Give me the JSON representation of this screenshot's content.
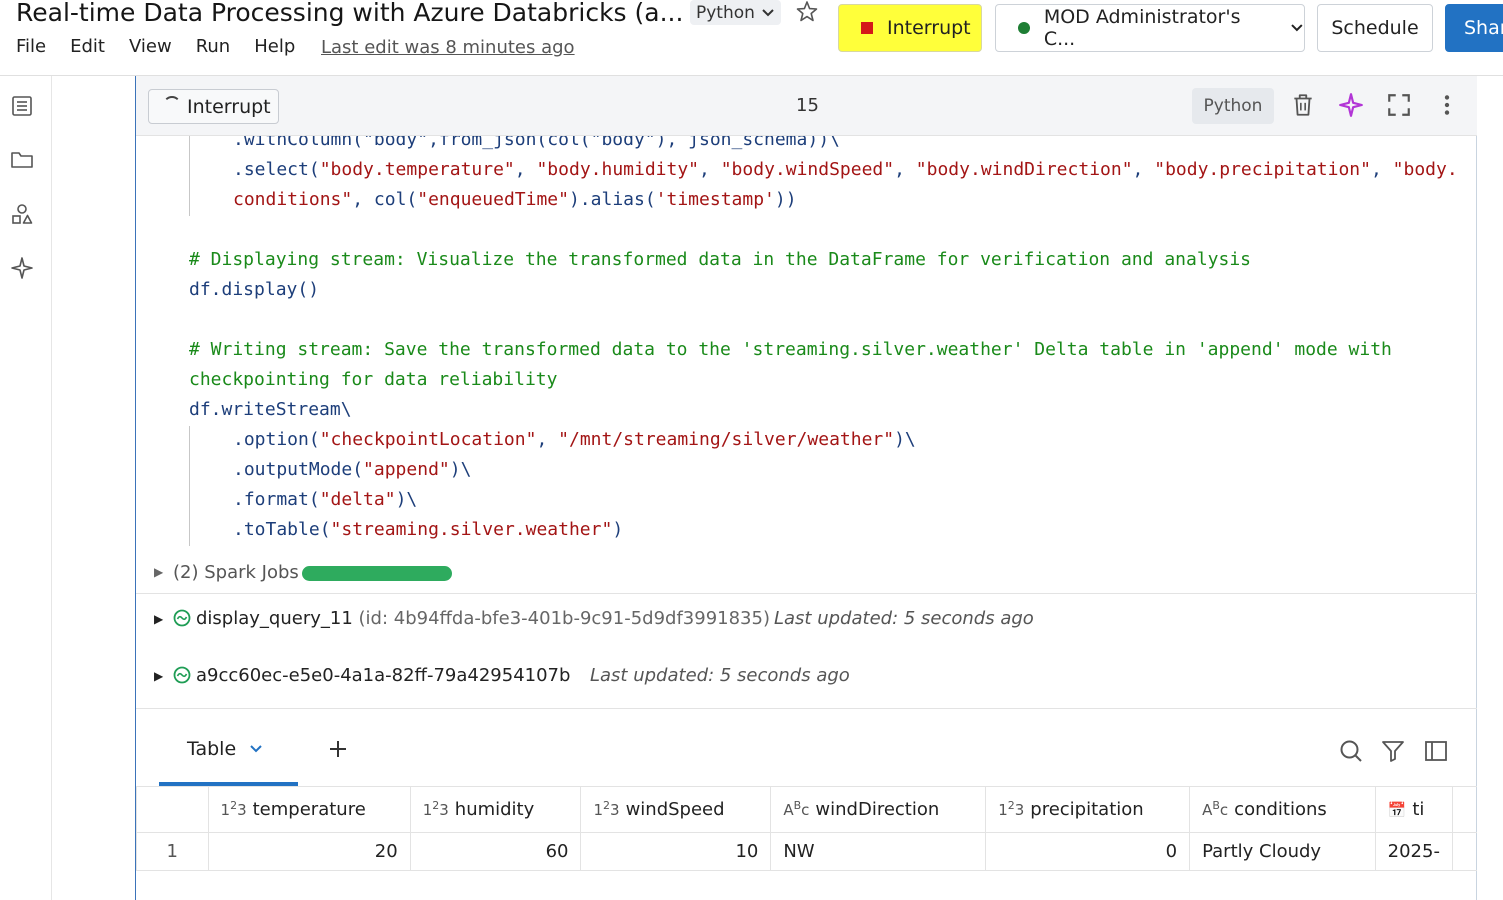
{
  "header": {
    "title": "Real-time Data Processing with Azure Databricks (a...",
    "language": "Python",
    "menu": [
      "File",
      "Edit",
      "View",
      "Run",
      "Help"
    ],
    "last_edit": "Last edit was 8 minutes ago",
    "interrupt_label": "Interrupt",
    "cluster_label": "MOD Administrator's C...",
    "schedule_label": "Schedule",
    "share_label": "Shar"
  },
  "cell": {
    "interrupt_label": "Interrupt",
    "number": "15",
    "language": "Python"
  },
  "code": {
    "line0": ".withColumn(\"body\",from_json(col(\"body\"), json_schema))\\",
    "line1a": ".select(",
    "line1b": "\"body.temperature\"",
    "line1c": ", ",
    "line1d": "\"body.humidity\"",
    "line1e": ", ",
    "line1f": "\"body.windSpeed\"",
    "line1g": ", ",
    "line1h": "\"body.windDirection\"",
    "line1i": ", ",
    "line1j": "\"body.precipitation\"",
    "line1k": ", ",
    "line1l": "\"body.",
    "line2a": "conditions\"",
    "line2b": ", col(",
    "line2c": "\"enqueuedTime\"",
    "line2d": ").alias(",
    "line2e": "'timestamp'",
    "line2f": "))",
    "comment1": "# Displaying stream: Visualize the transformed data in the DataFrame for verification and analysis",
    "display": "df.display()",
    "comment2a": "# Writing stream: Save the transformed data to the 'streaming.silver.weather' Delta table in 'append' mode with",
    "comment2b": "checkpointing for data reliability",
    "write": "df.writeStream\\",
    "opt_a": ".option(",
    "opt_b": "\"checkpointLocation\"",
    "opt_c": ", ",
    "opt_d": "\"/mnt/streaming/silver/weather\"",
    "opt_e": ")\\",
    "mode_a": ".outputMode(",
    "mode_b": "\"append\"",
    "mode_c": ")\\",
    "fmt_a": ".format(",
    "fmt_b": "\"delta\"",
    "fmt_c": ")\\",
    "tbl_a": ".toTable(",
    "tbl_b": "\"streaming.silver.weather\"",
    "tbl_c": ")"
  },
  "spark": {
    "label": "(2) Spark Jobs",
    "progress": 1.0,
    "color": "#2eab5e"
  },
  "queries": [
    {
      "name": "display_query_11",
      "id": "(id: 4b94ffda-bfe3-401b-9c91-5d9df3991835)",
      "updated": "Last updated: 5 seconds ago"
    },
    {
      "name": "a9cc60ec-e5e0-4a1a-82ff-79a42954107b",
      "id": "",
      "updated": "Last updated: 5 seconds ago"
    }
  ],
  "results": {
    "tab_label": "Table",
    "columns": [
      {
        "type": "123",
        "name": "temperature"
      },
      {
        "type": "123",
        "name": "humidity"
      },
      {
        "type": "123",
        "name": "windSpeed"
      },
      {
        "type": "ABC",
        "name": "windDirection"
      },
      {
        "type": "123",
        "name": "precipitation"
      },
      {
        "type": "ABC",
        "name": "conditions"
      },
      {
        "type": "date",
        "name": "ti"
      }
    ],
    "rows": [
      {
        "index": "1",
        "temperature": "20",
        "humidity": "60",
        "windSpeed": "10",
        "windDirection": "NW",
        "precipitation": "0",
        "conditions": "Partly Cloudy",
        "timestamp": "2025-"
      }
    ]
  },
  "colors": {
    "accent": "#2272c3",
    "highlight": "#ffff3a",
    "status_green": "#1e7e34"
  }
}
